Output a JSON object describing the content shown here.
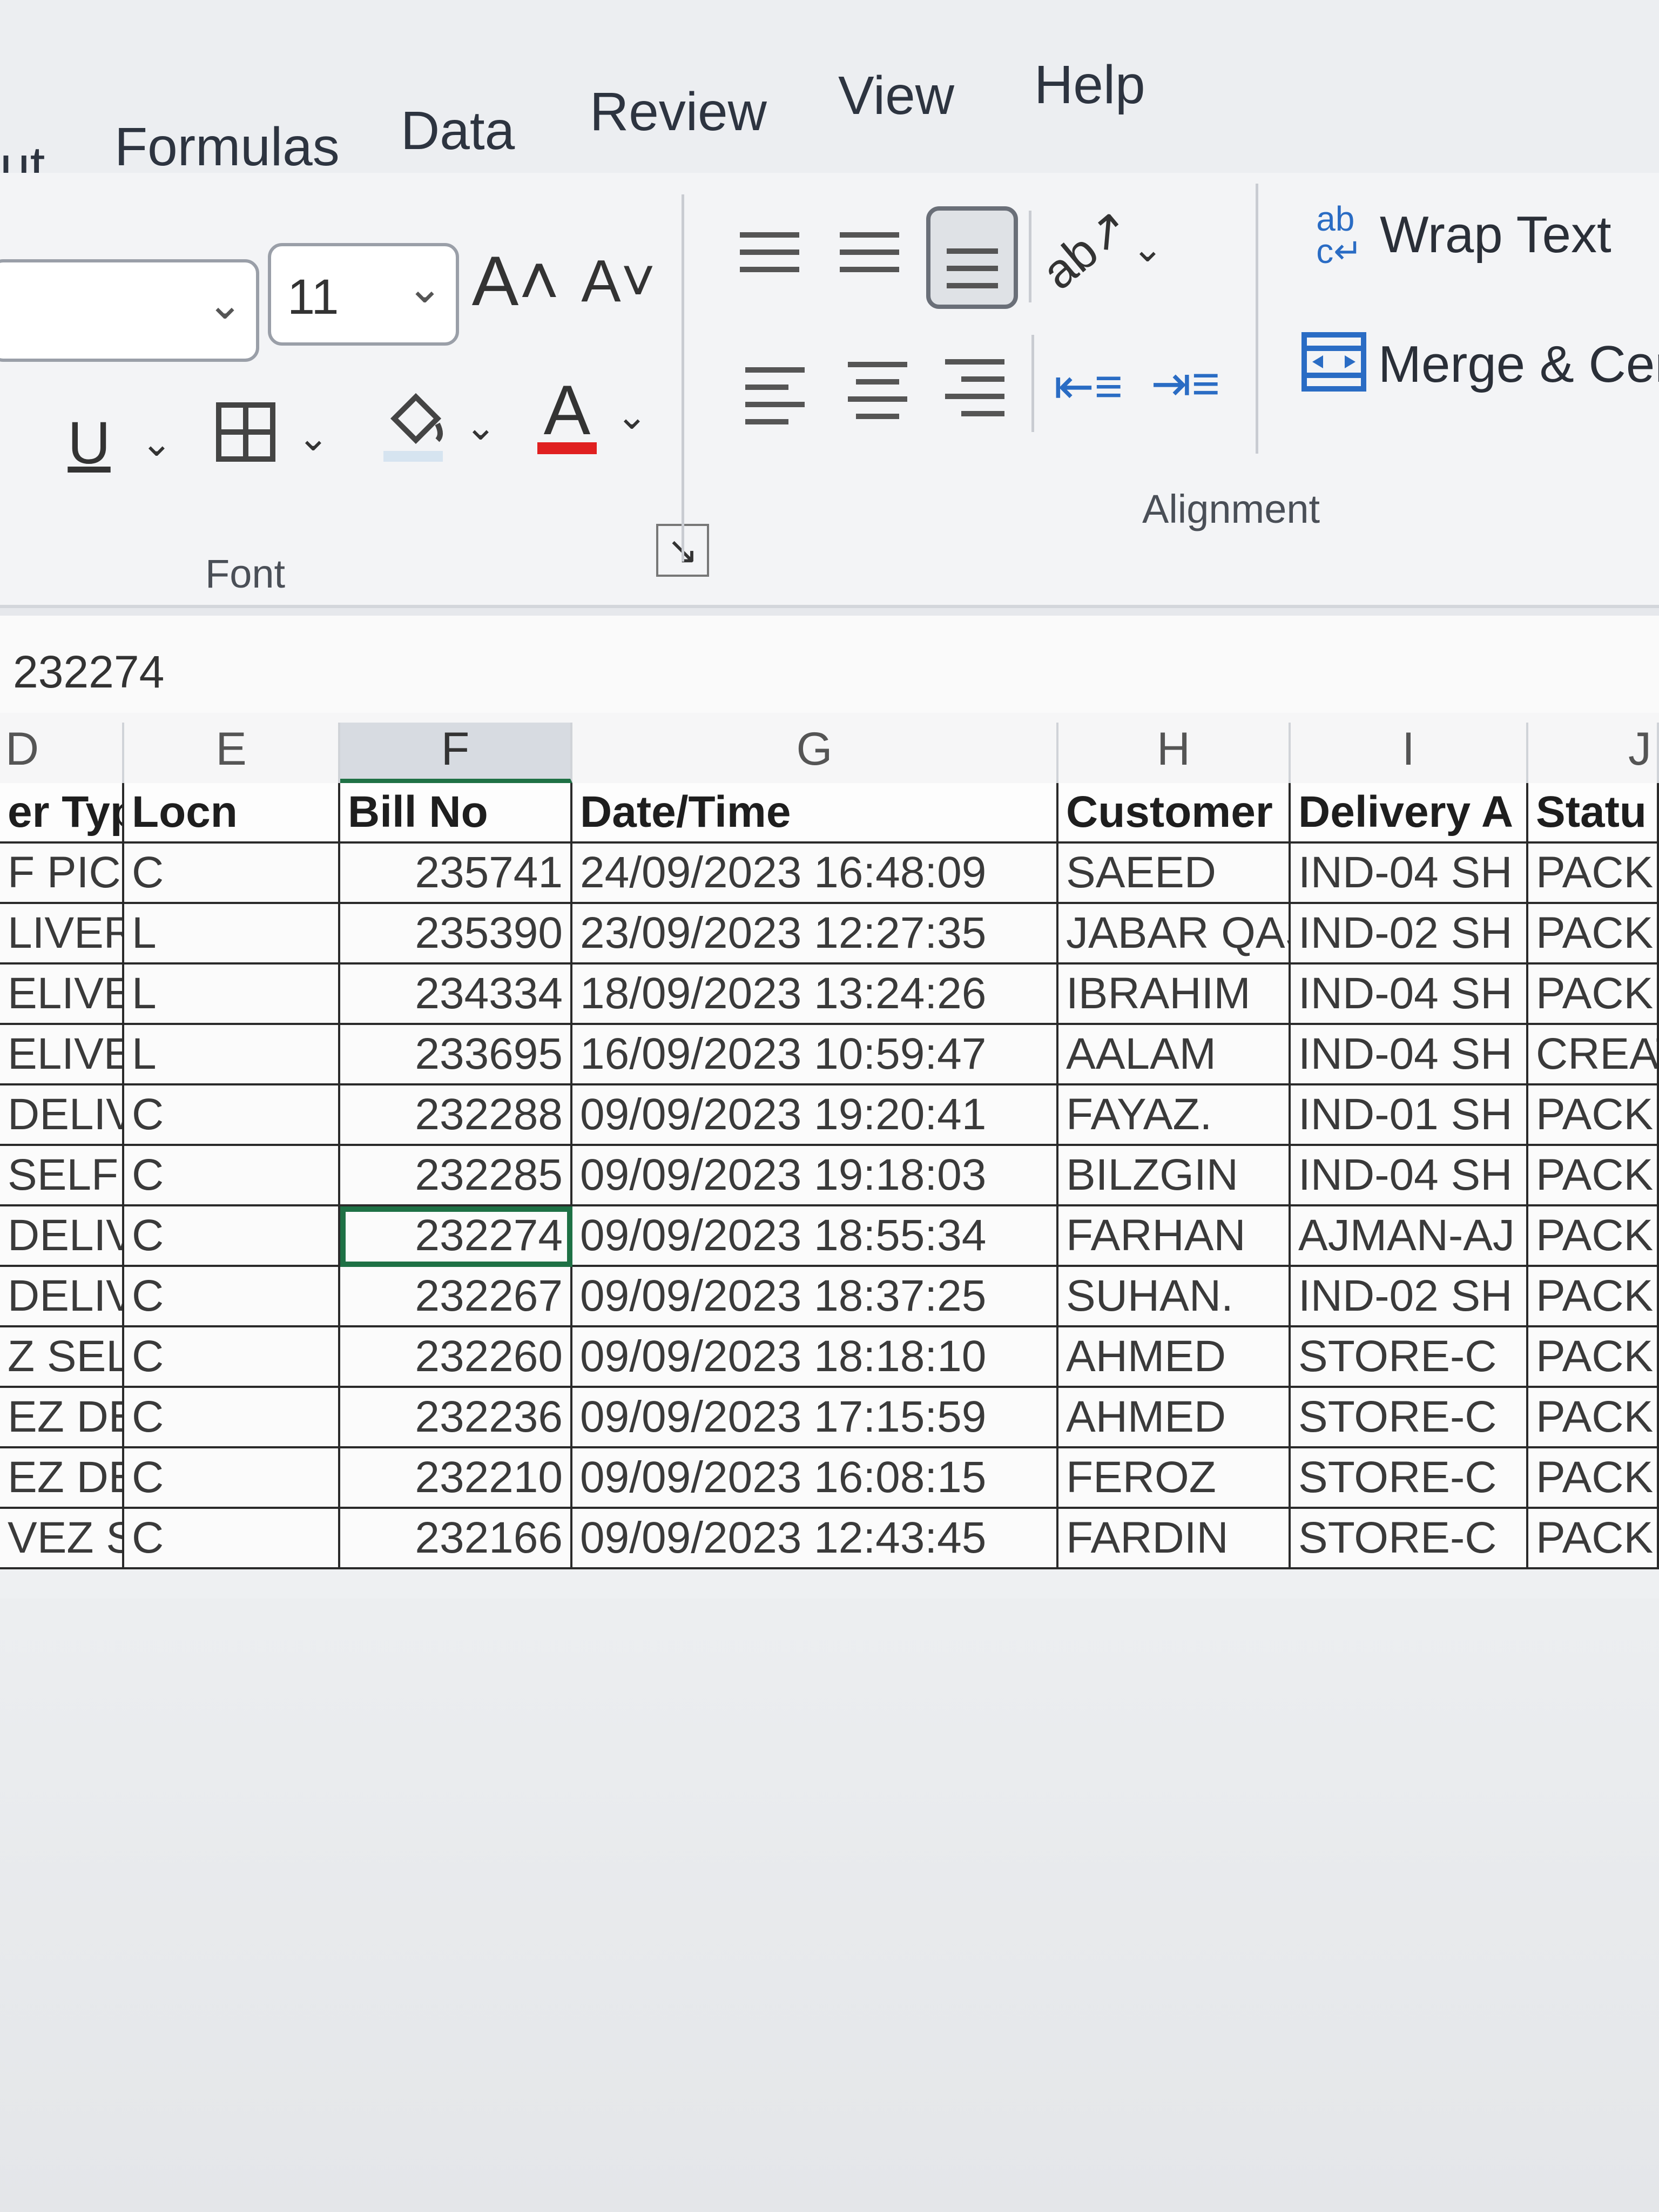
{
  "menu": {
    "tabs": [
      "ut",
      "Formulas",
      "Data",
      "Review",
      "View",
      "Help"
    ]
  },
  "ribbon": {
    "font_group": {
      "font_size": "11",
      "grow_font_icon": "A˄",
      "shrink_font_icon": "A˅",
      "underline": "U",
      "font_color_letter": "A",
      "font_color": "#e02020",
      "label": "Font"
    },
    "alignment_group": {
      "wrap_text_label": "Wrap Text",
      "merge_label": "Merge & Cen",
      "label": "Alignment"
    }
  },
  "formula_bar": {
    "value": "232274"
  },
  "columns": [
    "D",
    "E",
    "F",
    "G",
    "H",
    "I",
    "J"
  ],
  "table": {
    "headers": [
      "er Typ",
      "Locn",
      "Bill No",
      "Date/Time",
      "Customer",
      "Delivery A",
      "Statu"
    ],
    "rows": [
      [
        "F PICKU",
        "C",
        "235741",
        "24/09/2023 16:48:09",
        "SAEED",
        "IND-04 SH",
        "PACKI"
      ],
      [
        "LIVERY",
        "L",
        "235390",
        "23/09/2023 12:27:35",
        "JABAR QAS",
        "IND-02 SH",
        "PACKE"
      ],
      [
        "ELIVERY",
        "L",
        "234334",
        "18/09/2023 13:24:26",
        "IBRAHIM",
        "IND-04 SH",
        "PACKE"
      ],
      [
        "ELIVERY",
        "L",
        "233695",
        "16/09/2023 10:59:47",
        "AALAM",
        "IND-04 SH",
        "CREAT"
      ],
      [
        "DELIVERY",
        "C",
        "232288",
        "09/09/2023 19:20:41",
        "FAYAZ.",
        "IND-01 SH",
        "PACKE"
      ],
      [
        "SELF PICKU",
        "C",
        "232285",
        "09/09/2023 19:18:03",
        "BILZGIN",
        "IND-04 SH",
        "PACKEI"
      ],
      [
        "DELIVERY",
        "C",
        "232274",
        "09/09/2023 18:55:34",
        "FARHAN",
        "AJMAN-AJ",
        "PACKED"
      ],
      [
        "DELIVERY",
        "C",
        "232267",
        "09/09/2023 18:37:25",
        "SUHAN.",
        "IND-02 SH",
        "PACKED"
      ],
      [
        "Z SELF PICKU",
        "C",
        "232260",
        "09/09/2023 18:18:10",
        "AHMED",
        "STORE-C",
        "PACKED"
      ],
      [
        "EZ DELIVERY",
        "C",
        "232236",
        "09/09/2023 17:15:59",
        "AHMED",
        "STORE-C",
        "PACKED"
      ],
      [
        "EZ DELIVERY",
        "C",
        "232210",
        "09/09/2023 16:08:15",
        "FEROZ",
        "STORE-C",
        "PACKED"
      ],
      [
        "VEZ SELF PICKU",
        "C",
        "232166",
        "09/09/2023 12:43:45",
        "FARDIN",
        "STORE-C",
        "PACKED"
      ]
    ],
    "active_cell": {
      "row": 6,
      "col": 2
    },
    "selected_column": "F"
  }
}
